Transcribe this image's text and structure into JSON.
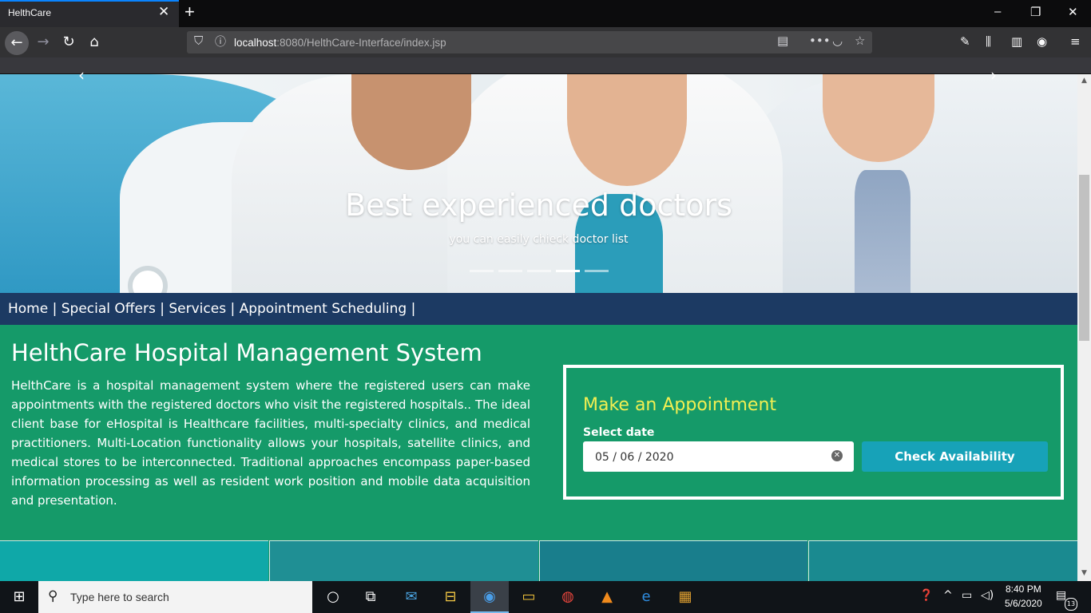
{
  "browser": {
    "tab_title": "HelthCare",
    "tab_close": "✕",
    "new_tab": "+",
    "url_host": "localhost",
    "url_rest": ":8080/HelthCare-Interface/index.jsp",
    "window_controls": {
      "minimize": "–",
      "restore": "❐",
      "close": "✕"
    }
  },
  "carousel": {
    "title": "Best experienced doctors",
    "subtitle": "you can easily chieck doctor list",
    "slide_count": 5,
    "active_slide": 4
  },
  "menu": {
    "items": [
      "Home",
      "Special Offers",
      "Services",
      "Appointment Scheduling"
    ],
    "separator": " | "
  },
  "main": {
    "title": "HelthCare Hospital Management System",
    "description": "HelthCare is a hospital management system where the registered users can make appointments with the registered doctors who visit the registered hospitals.. The ideal client base for eHospital is Healthcare facilities, multi-specialty clinics, and medical practitioners. Multi-Location functionality allows your hospitals, satellite clinics, and medical stores to be interconnected. Traditional approaches encompass paper-based information processing as well as resident work position and mobile data acquisition and presentation."
  },
  "appointment": {
    "title": "Make an Appointment",
    "date_label": "Select date",
    "date_value": "05 / 06 / 2020",
    "check_button": "Check Availability"
  },
  "tiles": [
    {
      "color": "#0fa8a8"
    },
    {
      "color": "#1f8f94"
    },
    {
      "color": "#197e8c"
    },
    {
      "color": "#1a8a90"
    }
  ],
  "taskbar": {
    "search_placeholder": "Type here to search",
    "time": "8:40 PM",
    "date": "5/6/2020",
    "notification_count": "13"
  },
  "colors": {
    "menu_bg": "#1c3a63",
    "main_bg": "#159a69",
    "appt_title": "#f2ef52",
    "button_bg": "#17a2b8"
  }
}
